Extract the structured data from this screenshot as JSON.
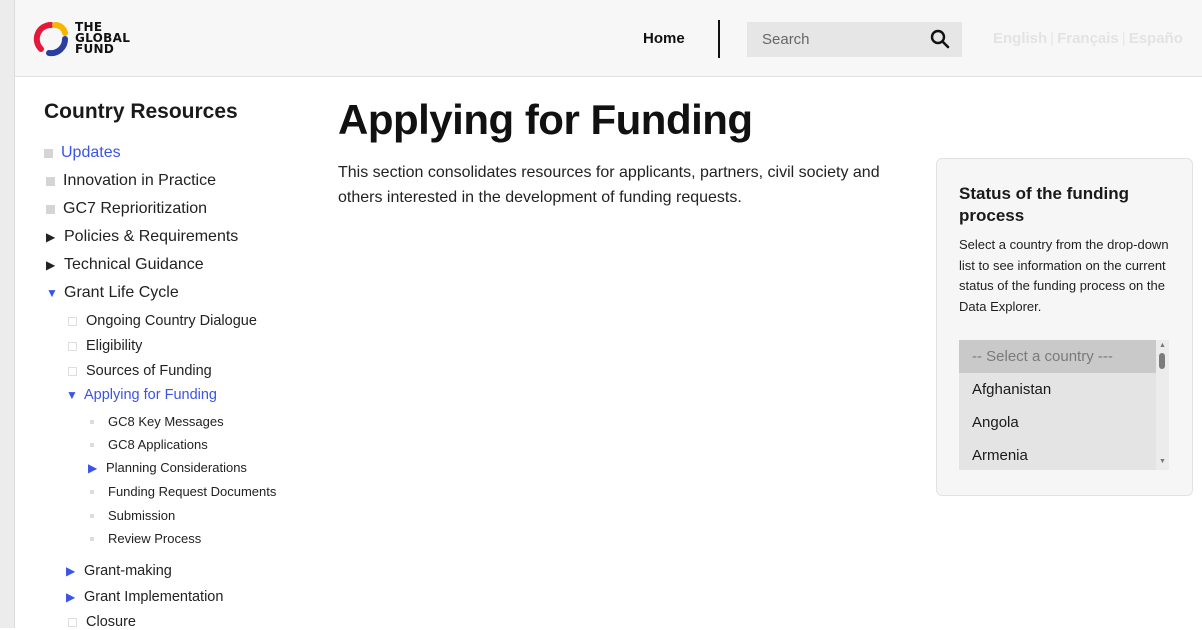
{
  "header": {
    "logo_lines": [
      "THE",
      "GLOBAL",
      "FUND"
    ],
    "nav_home": "Home",
    "search_placeholder": "Search",
    "languages": [
      "English",
      "Français",
      "Españo"
    ]
  },
  "sidebar": {
    "title": "Country Resources",
    "items": [
      {
        "label": "Updates"
      },
      {
        "label": "Innovation in Practice"
      },
      {
        "label": "GC7 Reprioritization"
      },
      {
        "label": "Policies & Requirements"
      },
      {
        "label": "Technical Guidance"
      },
      {
        "label": "Grant Life Cycle"
      },
      {
        "label": "Ongoing Country Dialogue"
      },
      {
        "label": "Eligibility"
      },
      {
        "label": "Sources of Funding"
      },
      {
        "label": "Applying for Funding"
      },
      {
        "label": "GC8 Key Messages"
      },
      {
        "label": "GC8 Applications"
      },
      {
        "label": "Planning Considerations"
      },
      {
        "label": "Funding Request Documents"
      },
      {
        "label": "Submission"
      },
      {
        "label": "Review Process"
      },
      {
        "label": "Grant-making"
      },
      {
        "label": "Grant Implementation"
      },
      {
        "label": "Closure"
      }
    ]
  },
  "main": {
    "title": "Applying for Funding",
    "intro": "This section consolidates resources for applicants, partners, civil society and others interested in the development of funding requests."
  },
  "status_panel": {
    "title": "Status of the funding process",
    "description": "Select a country from the drop-down list to see information on the current status of the funding process on the Data Explorer.",
    "options": [
      "-- Select a country ---",
      "Afghanistan",
      "Angola",
      "Armenia"
    ]
  },
  "colors": {
    "accent": "#3a55e6",
    "logo_red": "#e5183b",
    "logo_yellow": "#f7b500",
    "logo_blue": "#2a3ea0"
  }
}
